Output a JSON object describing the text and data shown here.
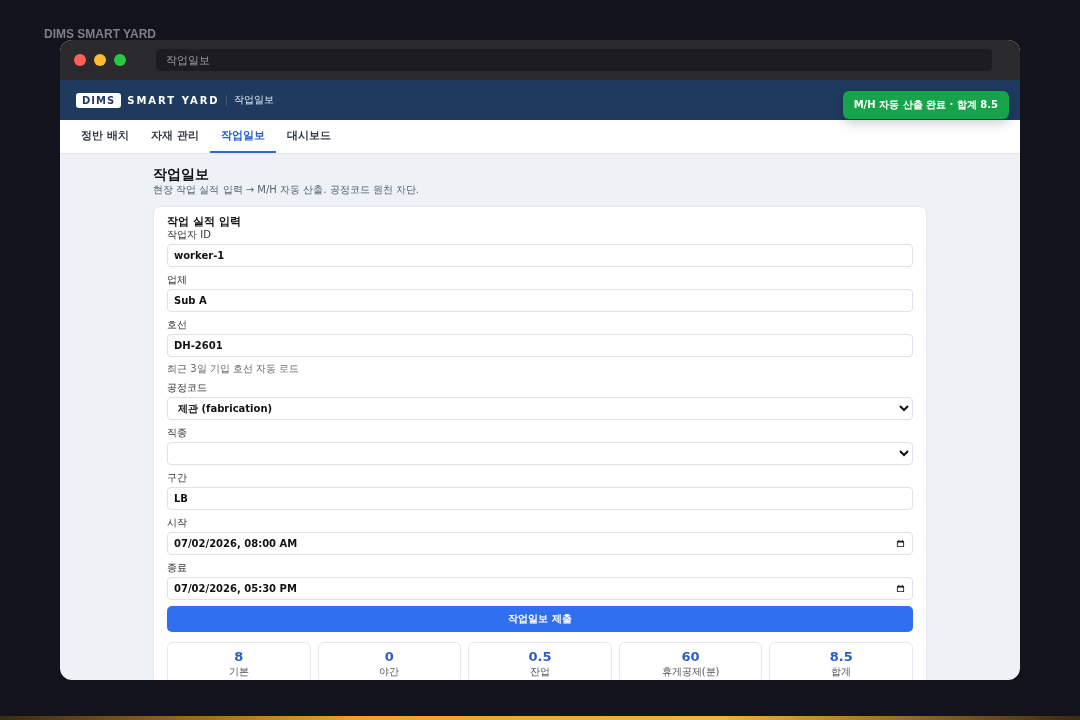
{
  "desktop_caption": "DIMS SMART YARD",
  "window": {
    "address": "작업일보"
  },
  "header": {
    "logo_badge": "DIMS",
    "logo_text": "SMART YARD",
    "page": "작업일보"
  },
  "toast": {
    "text": "M/H 자동 산출 완료 · 합계 8.5"
  },
  "tabs": [
    {
      "label": "정반 배치",
      "selected": false
    },
    {
      "label": "자재 관리",
      "selected": false
    },
    {
      "label": "작업일보",
      "selected": true
    },
    {
      "label": "대시보드",
      "selected": false
    }
  ],
  "page": {
    "title": "작업일보",
    "subtitle": "현장 작업 실적 입력 → M/H 자동 산출. 공정코드 원천 차단."
  },
  "form": {
    "title": "작업 실적 입력",
    "fields": [
      {
        "kind": "text",
        "label": "작업자 ID",
        "value": "worker-1"
      },
      {
        "kind": "text",
        "label": "업체",
        "value": "Sub A"
      },
      {
        "kind": "text",
        "label": "호선",
        "value": "DH-2601",
        "hint": "최근 3일 기입 호선 자동 로드"
      },
      {
        "kind": "select",
        "label": "공정코드",
        "value": "제관 (fabrication)"
      },
      {
        "kind": "select",
        "label": "직종"
      },
      {
        "kind": "text",
        "label": "구간",
        "value": "LB"
      },
      {
        "kind": "datetime",
        "label": "시작",
        "value": "07/02/2026, 08:00 AM"
      },
      {
        "kind": "datetime",
        "label": "종료",
        "value": "07/02/2026, 05:30 PM"
      }
    ],
    "submit": "작업일보 제출"
  },
  "stats": [
    {
      "value": "8",
      "label": "기본"
    },
    {
      "value": "0",
      "label": "야간"
    },
    {
      "value": "0.5",
      "label": "잔업"
    },
    {
      "value": "60",
      "label": "휴게공제(분)"
    },
    {
      "value": "8.5",
      "label": "합계"
    }
  ]
}
